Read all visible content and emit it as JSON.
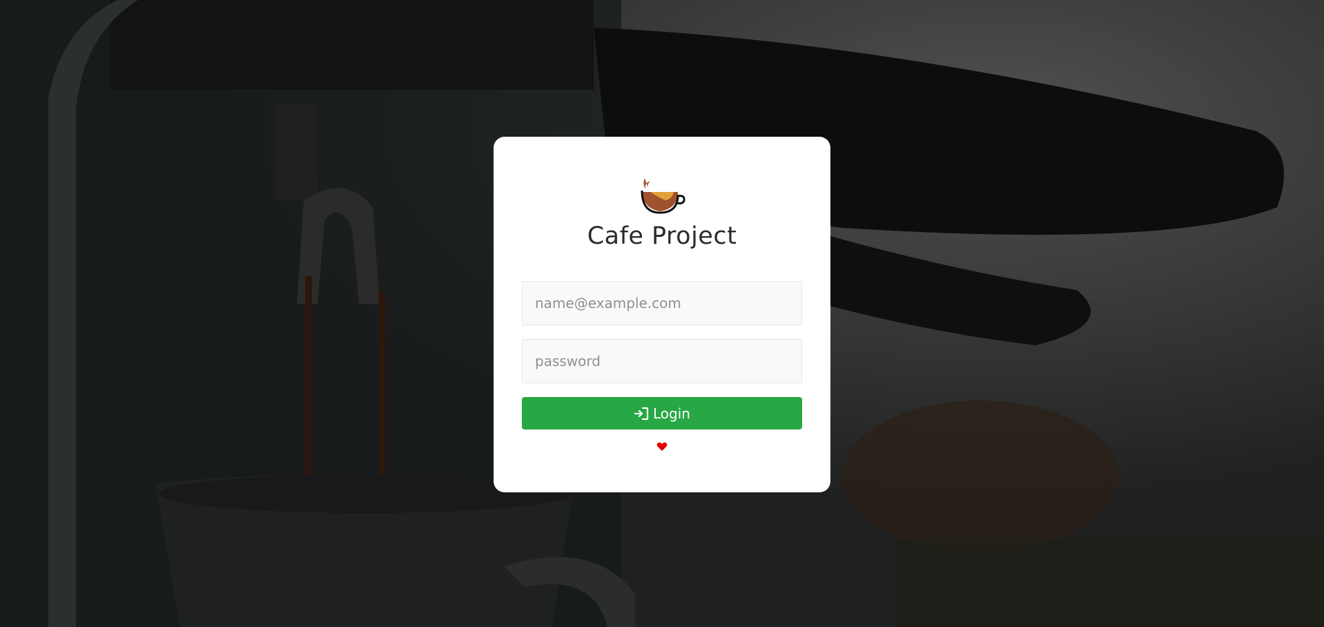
{
  "app": {
    "title": "Cafe Project"
  },
  "login_form": {
    "email_placeholder": "name@example.com",
    "password_placeholder": "password",
    "login_label": "Login"
  },
  "icons": {
    "logo": "coffee-cup-logo-icon",
    "login": "sign-in-icon",
    "footer": "heart-icon"
  },
  "colors": {
    "button": "#28a745",
    "heart": "#e00000",
    "card": "#ffffff"
  }
}
